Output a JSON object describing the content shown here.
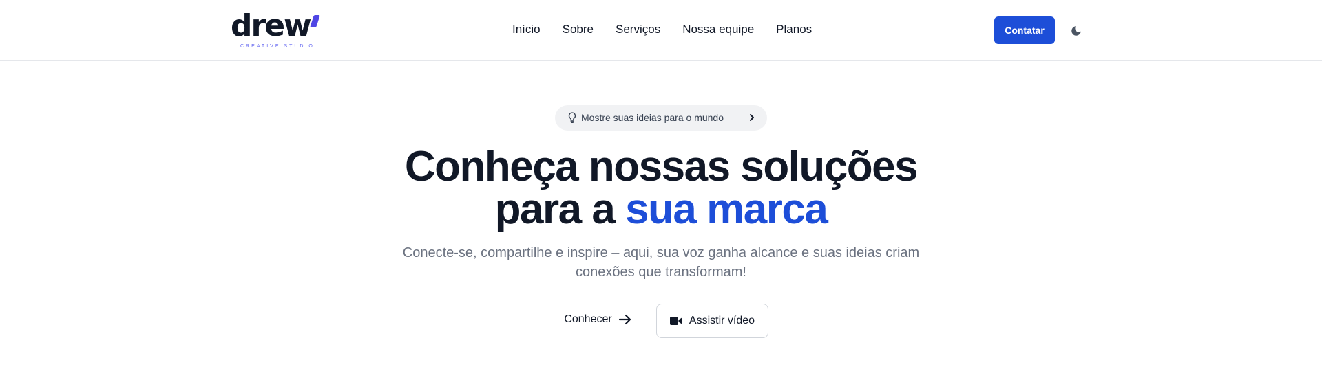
{
  "brand": {
    "wordmark": "drew",
    "tagline": "CREATIVE STUDIO",
    "accent_color": "#4f46e5"
  },
  "nav": {
    "items": [
      {
        "label": "Início"
      },
      {
        "label": "Sobre"
      },
      {
        "label": "Serviços"
      },
      {
        "label": "Nossa equipe"
      },
      {
        "label": "Planos"
      }
    ]
  },
  "header": {
    "contact_label": "Contatar",
    "contact_color": "#1d4ed8",
    "theme_icon": "moon-icon"
  },
  "hero": {
    "pill": {
      "icon": "lightbulb-icon",
      "text": "Mostre suas ideias para o mundo",
      "arrow_icon": "chevron-right-icon"
    },
    "headline_line1": "Conheça nossas soluções",
    "headline_line2_prefix": "para a ",
    "headline_line2_accent": "sua marca",
    "accent_color": "#1d4ed8",
    "subtitle": "Conecte-se, compartilhe e inspire – aqui, sua voz ganha alcance e suas ideias criam conexões que transformam!",
    "primary_button": {
      "label": "Conhecer",
      "icon": "arrow-right-icon"
    },
    "secondary_button": {
      "label": "Assistir vídeo",
      "icon": "video-camera-icon"
    }
  }
}
